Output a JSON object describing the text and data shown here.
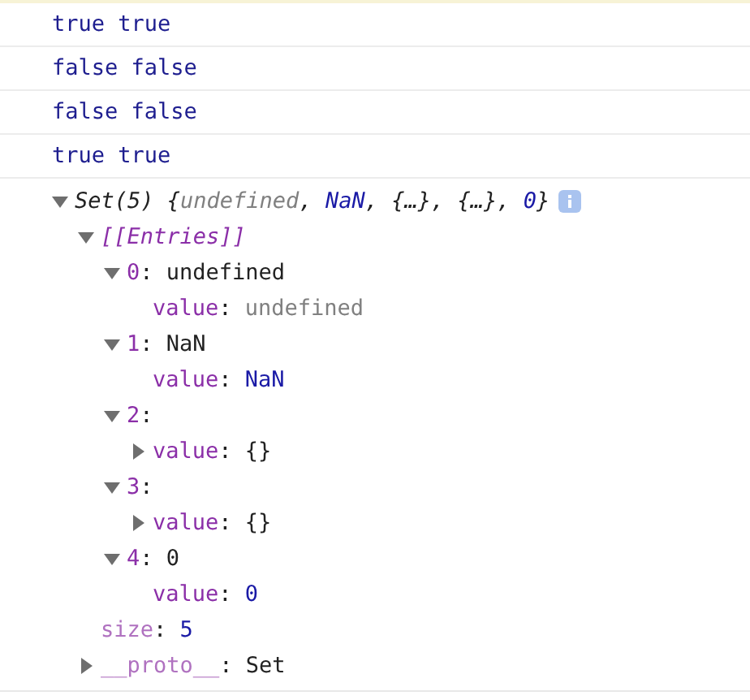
{
  "logs": [
    {
      "text": "true true"
    },
    {
      "text": "false false"
    },
    {
      "text": "false false"
    },
    {
      "text": "true true"
    }
  ],
  "object": {
    "expanded": true,
    "summary": [
      {
        "kind": "plain",
        "text": "Set(5) {"
      },
      {
        "kind": "undefined",
        "text": "undefined"
      },
      {
        "kind": "plain",
        "text": ", "
      },
      {
        "kind": "number",
        "text": "NaN"
      },
      {
        "kind": "plain",
        "text": ", {…}, {…}, "
      },
      {
        "kind": "number",
        "text": "0"
      },
      {
        "kind": "plain",
        "text": "}"
      }
    ],
    "children": [
      {
        "parts": [
          {
            "kind": "internal",
            "text": "[[Entries]]"
          }
        ],
        "expanded": true,
        "children": [
          {
            "parts": [
              {
                "kind": "property",
                "text": "0"
              },
              {
                "kind": "plain",
                "text": ": undefined"
              }
            ],
            "expanded": true,
            "children": [
              {
                "parts": [
                  {
                    "kind": "property",
                    "text": "value"
                  },
                  {
                    "kind": "plain",
                    "text": ": "
                  },
                  {
                    "kind": "undefined",
                    "text": "undefined"
                  }
                ]
              }
            ]
          },
          {
            "parts": [
              {
                "kind": "property",
                "text": "1"
              },
              {
                "kind": "plain",
                "text": ": NaN"
              }
            ],
            "expanded": true,
            "children": [
              {
                "parts": [
                  {
                    "kind": "property",
                    "text": "value"
                  },
                  {
                    "kind": "plain",
                    "text": ": "
                  },
                  {
                    "kind": "number",
                    "text": "NaN"
                  }
                ]
              }
            ]
          },
          {
            "parts": [
              {
                "kind": "property",
                "text": "2"
              },
              {
                "kind": "plain",
                "text": ":"
              }
            ],
            "expanded": true,
            "children": [
              {
                "parts": [
                  {
                    "kind": "property",
                    "text": "value"
                  },
                  {
                    "kind": "plain",
                    "text": ": {}"
                  }
                ],
                "expanded": false
              }
            ]
          },
          {
            "parts": [
              {
                "kind": "property",
                "text": "3"
              },
              {
                "kind": "plain",
                "text": ":"
              }
            ],
            "expanded": true,
            "children": [
              {
                "parts": [
                  {
                    "kind": "property",
                    "text": "value"
                  },
                  {
                    "kind": "plain",
                    "text": ": {}"
                  }
                ],
                "expanded": false
              }
            ]
          },
          {
            "parts": [
              {
                "kind": "property",
                "text": "4"
              },
              {
                "kind": "plain",
                "text": ": 0"
              }
            ],
            "expanded": true,
            "children": [
              {
                "parts": [
                  {
                    "kind": "property",
                    "text": "value"
                  },
                  {
                    "kind": "plain",
                    "text": ": "
                  },
                  {
                    "kind": "number",
                    "text": "0"
                  }
                ]
              }
            ]
          }
        ]
      },
      {
        "parts": [
          {
            "kind": "dim",
            "text": "size"
          },
          {
            "kind": "plain",
            "text": ": "
          },
          {
            "kind": "number",
            "text": "5"
          }
        ]
      },
      {
        "parts": [
          {
            "kind": "dim",
            "text": "__proto__"
          },
          {
            "kind": "plain",
            "text": ": Set"
          }
        ],
        "expanded": false
      }
    ]
  }
}
